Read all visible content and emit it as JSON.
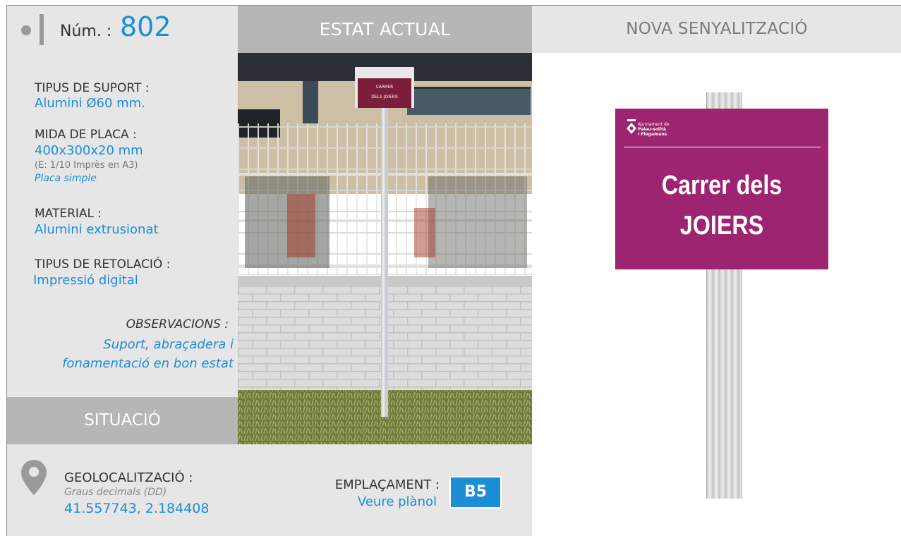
{
  "header": {
    "num_label": "Núm. :",
    "num_value": "802",
    "estat_title": "ESTAT ACTUAL",
    "nova_title": "NOVA SENYALITZACIÓ"
  },
  "details": {
    "suport_label": "TIPUS DE SUPORT :",
    "suport_value": "Alumini Ø60 mm.",
    "mida_label": "MIDA DE PLACA :",
    "mida_value": "400x300x20 mm",
    "mida_scale": "(E: 1/10 Imprès en A3)",
    "mida_type": "Placa simple",
    "material_label": "MATERIAL :",
    "material_value": "Alumini extrusionat",
    "retolacio_label": "TIPUS DE RETOLACIÓ :",
    "retolacio_value": "Impressió digital",
    "observacions_label": "OBSERVACIONS :",
    "observacions_line1": "Suport, abraçadera i",
    "observacions_line2": "fonamentació en bon estat"
  },
  "situacio": {
    "title": "SITUACIÓ",
    "geo_label": "GEOLOCALITZACIÓ :",
    "geo_format": "Graus decimals (DD)",
    "geo_value": "41.557743, 2.184408",
    "emplacament_label": "EMPLAÇAMENT :",
    "emplacament_link": "Veure plànol",
    "emplacament_code": "B5"
  },
  "photo": {
    "sign_line1": "CARRER",
    "sign_line2": "DELS JOIERS"
  },
  "new_sign": {
    "logo_line1": "Ajuntament de",
    "logo_line2": "Palau-solità",
    "logo_line3": "i Plegamans",
    "line1": "Carrer dels",
    "line2": "JOIERS",
    "color": "#9d2470"
  },
  "colors": {
    "accent": "#1b8ed6",
    "header_dark": "#b6b6b6",
    "panel": "#e6e6e6"
  }
}
